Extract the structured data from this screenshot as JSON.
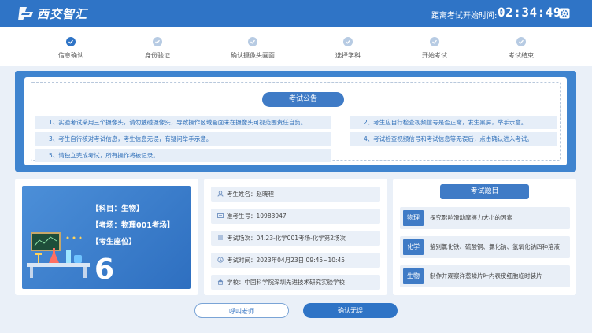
{
  "header": {
    "app_name": "西交智汇",
    "countdown_label": "距离考试开始时间:",
    "countdown_value": "02:34:49",
    "settings_icon": "gear-icon"
  },
  "steps": [
    {
      "label": "信息确认",
      "state": "done"
    },
    {
      "label": "身份验证",
      "state": "todo"
    },
    {
      "label": "确认摄像头画面",
      "state": "todo"
    },
    {
      "label": "选择学科",
      "state": "todo"
    },
    {
      "label": "开始考试",
      "state": "todo"
    },
    {
      "label": "考试结束",
      "state": "todo"
    }
  ],
  "notice": {
    "title": "考试公告",
    "rules": [
      "1、实验考试采用三个摄像头，请勿触碰摄像头，导致操作区域画面未在摄像头可视范围责任自负。",
      "2、考生应自行检查视频信号是否正常，发生黑屏，举手示意。",
      "3、考生自行核对考试信息，考生信息无误，有疑问举手示意。",
      "4、考试检查视频信号和考试信息等无误后，点击确认进入考试。",
      "5、请独立完成考试，所有操作将被记录。"
    ]
  },
  "seat": {
    "subject": "【科目：生物】",
    "room": "【考场：物理001考场】",
    "seat_label": "【考生座位】",
    "seat_number": "6"
  },
  "student": {
    "name": "考生姓名：赵晓程",
    "ticket": "准考生号：10983947",
    "session": "考试场次：04.23-化学001考场-化学第2场次",
    "time": "考试时间：2023年04月23日 09:45~10:45",
    "school": "学校：中国科学院深圳先进技术研究实验学校"
  },
  "questions": {
    "title": "考试题目",
    "items": [
      {
        "tag": "物理",
        "text": "探究影响滑动摩擦力大小的因素"
      },
      {
        "tag": "化学",
        "text": "鉴别氯化铁、硫酸铜、氯化钠、氢氧化钠四种溶液"
      },
      {
        "tag": "生物",
        "text": "制作并观察洋葱鳞片叶内表皮细胞临时装片"
      }
    ]
  },
  "actions": {
    "call_teacher": "呼叫老师",
    "confirm": "确认无误"
  },
  "colors": {
    "primary": "#2f74c6",
    "light": "#eaf0f8",
    "todo": "#b7cbe3"
  }
}
